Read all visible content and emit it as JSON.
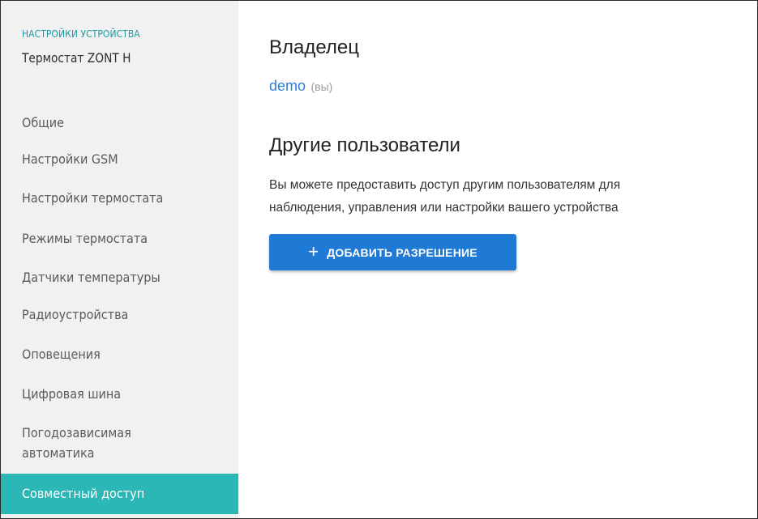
{
  "sidebar": {
    "caption": "НАСТРОЙКИ УСТРОЙСТВА",
    "device_name": "Термостат ZONT H",
    "items": [
      {
        "label": "Общие"
      },
      {
        "label": "Настройки GSM"
      },
      {
        "label": "Настройки термостата"
      },
      {
        "label": "Режимы термостата"
      },
      {
        "label": "Датчики температуры"
      },
      {
        "label": "Радиоустройства"
      },
      {
        "label": "Оповещения"
      },
      {
        "label": "Цифровая шина"
      },
      {
        "label_line1": "Погодозависимая",
        "label_line2": "автоматика"
      },
      {
        "label": "Совместный доступ",
        "active": true
      }
    ]
  },
  "main": {
    "owner_heading": "Владелец",
    "owner_name": "demo",
    "owner_you": "(вы)",
    "others_heading": "Другие пользователи",
    "description_line1": "Вы можете предоставить доступ другим пользователям для",
    "description_line2": "наблюдения, управления или настройки вашего устройства",
    "add_button_icon": "plus-icon",
    "add_button_label": "ДОБАВИТЬ РАЗРЕШЕНИЕ"
  },
  "colors": {
    "accent_teal": "#2ab7b5",
    "caption_teal": "#1a9aa3",
    "button_blue": "#1f7ad6",
    "link_blue": "#2b7fd6",
    "sidebar_bg": "#f1f1f1"
  }
}
